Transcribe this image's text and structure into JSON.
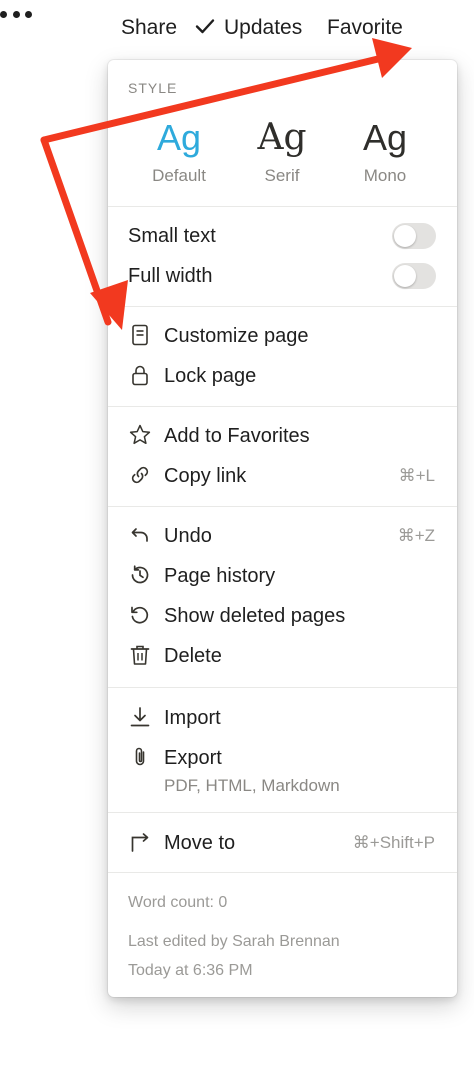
{
  "topbar": {
    "share": "Share",
    "updates": "Updates",
    "favorite": "Favorite"
  },
  "menu": {
    "style_heading": "STYLE",
    "styles": [
      {
        "glyph": "Ag",
        "label": "Default"
      },
      {
        "glyph": "Ag",
        "label": "Serif"
      },
      {
        "glyph": "Ag",
        "label": "Mono"
      }
    ],
    "toggles": [
      {
        "label": "Small text",
        "on": false
      },
      {
        "label": "Full width",
        "on": false
      }
    ],
    "page_items": [
      {
        "label": "Customize page",
        "icon": "document-icon"
      },
      {
        "label": "Lock page",
        "icon": "lock-icon"
      }
    ],
    "share_items": [
      {
        "label": "Add to Favorites",
        "icon": "star-icon"
      },
      {
        "label": "Copy link",
        "icon": "link-icon",
        "shortcut": "⌘+L"
      }
    ],
    "history_items": [
      {
        "label": "Undo",
        "icon": "undo-icon",
        "shortcut": "⌘+Z"
      },
      {
        "label": "Page history",
        "icon": "history-icon"
      },
      {
        "label": "Show deleted pages",
        "icon": "restore-icon"
      },
      {
        "label": "Delete",
        "icon": "trash-icon"
      }
    ],
    "io_items": [
      {
        "label": "Import",
        "icon": "download-icon"
      },
      {
        "label": "Export",
        "icon": "paperclip-icon",
        "sublabel": "PDF, HTML, Markdown"
      }
    ],
    "move_item": {
      "label": "Move to",
      "icon": "move-arrow-icon",
      "shortcut": "⌘+Shift+P"
    },
    "footer": {
      "word_count": "Word count: 0",
      "last_edited": "Last edited by Sarah Brennan",
      "edited_time": "Today at 6:36 PM"
    }
  },
  "colors": {
    "accent": "#2eaadc",
    "annotation_arrow": "#f2391f",
    "toggle_off": "#e3e2e0"
  }
}
